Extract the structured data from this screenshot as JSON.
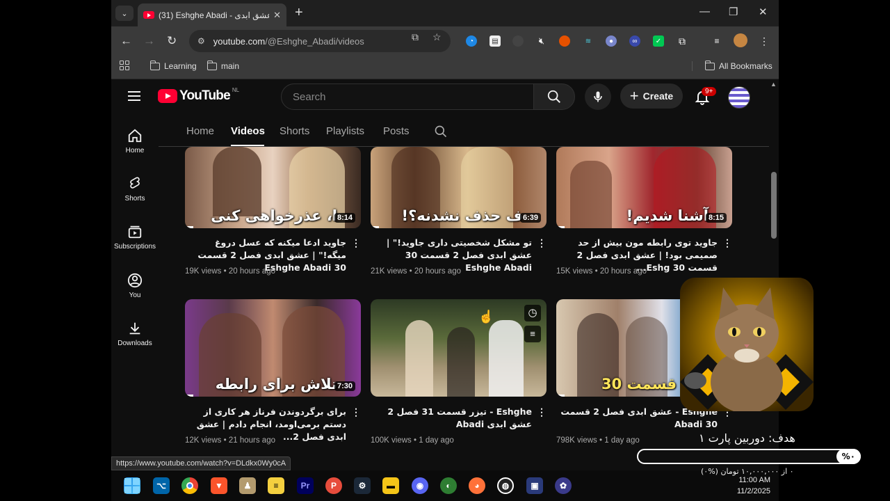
{
  "browser": {
    "tab_title": "(31) Eshghe Abadi - عشق ابدی",
    "url_host": "youtube.com",
    "url_path": "/@Eshghe_Abadi/videos",
    "bookmarks": [
      "Learning",
      "main"
    ],
    "all_bookmarks": "All Bookmarks",
    "status_url": "https://www.youtube.com/watch?v=DLdkx0Wy0cA"
  },
  "youtube": {
    "logo": "YouTube",
    "country": "NL",
    "search_placeholder": "Search",
    "create_label": "Create",
    "notifications_badge": "9+",
    "sidebar": [
      {
        "label": "Home",
        "icon": "home-icon"
      },
      {
        "label": "Shorts",
        "icon": "shorts-icon"
      },
      {
        "label": "Subscriptions",
        "icon": "subscriptions-icon"
      },
      {
        "label": "You",
        "icon": "you-icon"
      },
      {
        "label": "Downloads",
        "icon": "download-icon"
      }
    ],
    "channel_tabs": [
      "Home",
      "Videos",
      "Shorts",
      "Playlists",
      "Posts"
    ],
    "active_tab": "Videos",
    "videos": [
      {
        "thumb_text": "ا، عذرخواهی کنی",
        "duration": "8:14",
        "title": "جاوید ادعا میکنه که عسل دروغ میگه!\" | عشق ابدی فصل 2 قسمت 30 Eshghe Abadi",
        "views": "19K views",
        "age": "20 hours ago"
      },
      {
        "thumb_text": "ف حذف نشدنه؟!",
        "duration": "6:39",
        "title": "تو مشکل شخصیتی داری جاوید!\" | عشق ابدی فصل 2 قسمت 30 Eshghe Abadi",
        "views": "21K views",
        "age": "20 hours ago"
      },
      {
        "thumb_text": "آشنا شدیم!",
        "duration": "8:15",
        "title": "جاوید توی رابطه مون بیش از حد صمیمی بود! | عشق ابدی فصل 2 قسمت 30 Eshg...",
        "views": "15K views",
        "age": "20 hours ago"
      },
      {
        "thumb_text": "تلاش برای رابطه",
        "duration": "7:30",
        "title": "برای برگردوندن فرناز هر کاری از دستم برمی‌اومد، انجام دادم | عشق ابدی فصل 2...",
        "views": "12K views",
        "age": "21 hours ago"
      },
      {
        "thumb_text": "",
        "duration": "",
        "title": "Eshghe - تیزر قسمت 31 فصل 2 عشق ابدی Abadi",
        "views": "100K views",
        "age": "1 day ago"
      },
      {
        "thumb_text": "قسمت 30",
        "duration": "",
        "title": "Eshghe - عشق ابدی فصل 2 قسمت 30 Abadi",
        "views": "798K views",
        "age": "1 day ago"
      }
    ]
  },
  "overlay": {
    "goal_title": "هدف: دوربین پارت ۱",
    "goal_percent": "%۰",
    "goal_sub": "۰ از ۱۰,۰۰۰,۰۰۰ تومان (%۰)"
  },
  "taskbar": {
    "time": "11:00 AM",
    "date": "11/2/2025"
  },
  "colors": {
    "youtube_red": "#ff0033",
    "background": "#0f0f0f",
    "badge_red": "#cc0000"
  }
}
